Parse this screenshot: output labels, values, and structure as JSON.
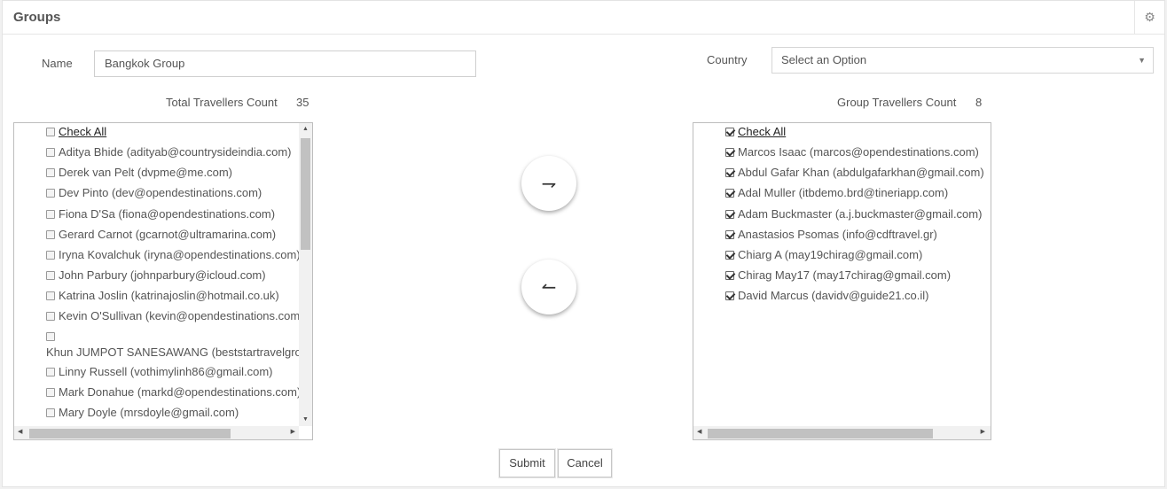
{
  "header": {
    "title": "Groups",
    "settings_icon": "gear-icon"
  },
  "form": {
    "name_label": "Name",
    "name_value": "Bangkok Group",
    "country_label": "Country",
    "country_value": "Select an Option"
  },
  "left": {
    "count_label": "Total Travellers Count",
    "count_value": "35",
    "check_all": "Check All",
    "items": [
      "Aditya Bhide (adityab@countrysideindia.com)",
      "Derek van Pelt (dvpme@me.com)",
      "Dev Pinto (dev@opendestinations.com)",
      "Fiona D'Sa (fiona@opendestinations.com)",
      "Gerard Carnot (gcarnot@ultramarina.com)",
      "Iryna Kovalchuk (iryna@opendestinations.com)",
      "John Parbury (johnparbury@icloud.com)",
      "Katrina Joslin (katrinajoslin@hotmail.co.uk)",
      "Kevin O'Sullivan (kevin@opendestinations.com)",
      "Khun JUMPOT SANESAWANG (beststartravelgrou",
      "Linny Russell (vothimylinh86@gmail.com)",
      "Mark Donahue (markd@opendestinations.com)",
      "Mary Doyle (mrsdoyle@gmail.com)"
    ]
  },
  "right": {
    "count_label": "Group Travellers Count",
    "count_value": "8",
    "check_all": "Check All",
    "items": [
      "Marcos Isaac (marcos@opendestinations.com)",
      "Abdul Gafar Khan (abdulgafarkhan@gmail.com)",
      "Adal Muller (itbdemo.brd@tineriapp.com)",
      "Adam Buckmaster (a.j.buckmaster@gmail.com)",
      "Anastasios Psomas (info@cdftravel.gr)",
      "Chiarg A (may19chirag@gmail.com)",
      "Chirag May17 (may17chirag@gmail.com)",
      "David Marcus (davidv@guide21.co.il)"
    ]
  },
  "actions": {
    "submit": "Submit",
    "cancel": "Cancel"
  }
}
